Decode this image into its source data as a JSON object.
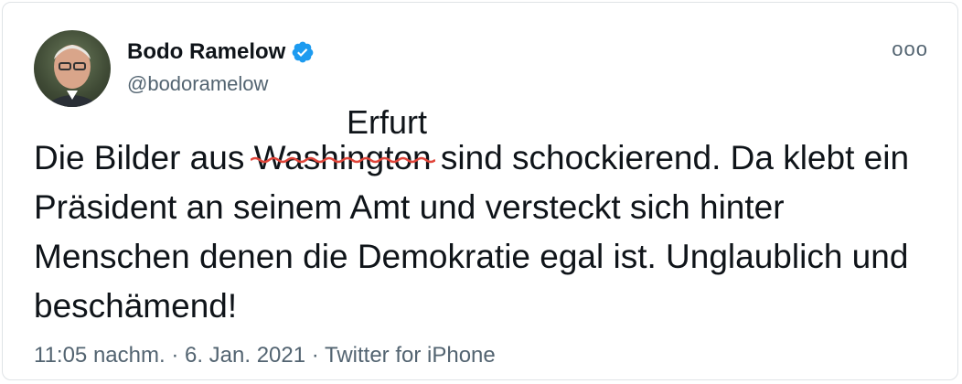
{
  "user": {
    "display_name": "Bodo Ramelow",
    "handle": "@bodoramelow",
    "verified_icon": "verified-badge-icon"
  },
  "menu": {
    "more_label": "ooo"
  },
  "annotation": {
    "text": "Erfurt"
  },
  "tweet": {
    "before": "Die Bilder aus ",
    "struck_word": "Washington",
    "after": " sind schockierend. Da klebt ein Präsident an seinem Amt und versteckt sich hinter Menschen denen die Demokratie egal ist. Unglaublich und beschämend!"
  },
  "meta": {
    "time": "11:05 nachm.",
    "sep1": " · ",
    "date": "6. Jan. 2021",
    "sep2": " · ",
    "source": "Twitter for iPhone"
  },
  "colors": {
    "accent": "#1d9bf0",
    "strike": "#e0453a",
    "muted": "#536471"
  }
}
